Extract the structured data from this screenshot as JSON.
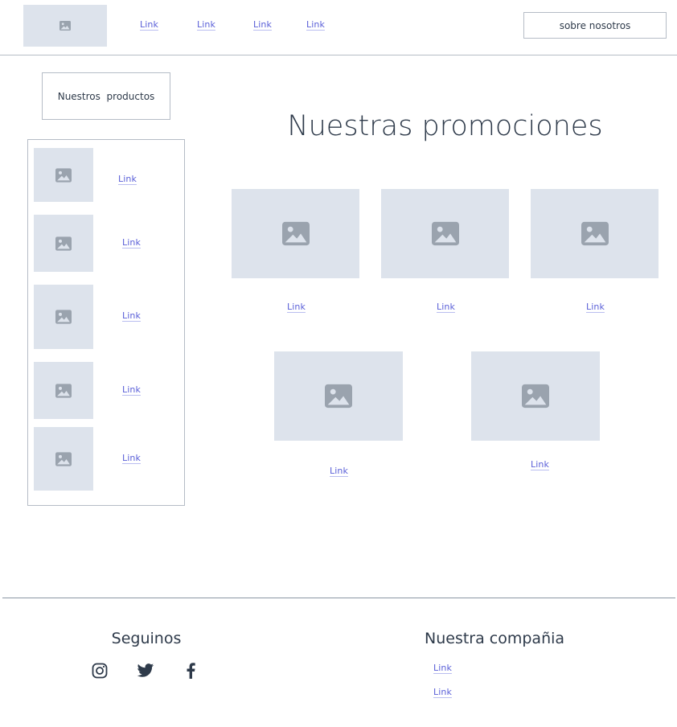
{
  "header": {
    "nav_links": [
      "Link",
      "Link",
      "Link",
      "Link"
    ],
    "about_button": "sobre nosotros"
  },
  "sidebar": {
    "products_button": "Nuestros  productos",
    "items": [
      {
        "link": "Link"
      },
      {
        "link": "Link"
      },
      {
        "link": "Link"
      },
      {
        "link": "Link"
      },
      {
        "link": "Link"
      }
    ]
  },
  "main": {
    "title": "Nuestras promociones",
    "promos": [
      {
        "link": "Link"
      },
      {
        "link": "Link"
      },
      {
        "link": "Link"
      },
      {
        "link": "Link"
      },
      {
        "link": "Link"
      }
    ]
  },
  "footer": {
    "social_title": "Seguinos",
    "social_icons": [
      "instagram-icon",
      "twitter-icon",
      "facebook-icon"
    ],
    "company_title": "Nuestra compañia",
    "company_links": [
      "Link",
      "Link"
    ]
  },
  "colors": {
    "link": "#5a5fd8",
    "placeholder": "#dde3ec",
    "placeholder_icon": "#9aa3ae",
    "text": "#2e3a4a",
    "border": "#b5bcc6"
  }
}
